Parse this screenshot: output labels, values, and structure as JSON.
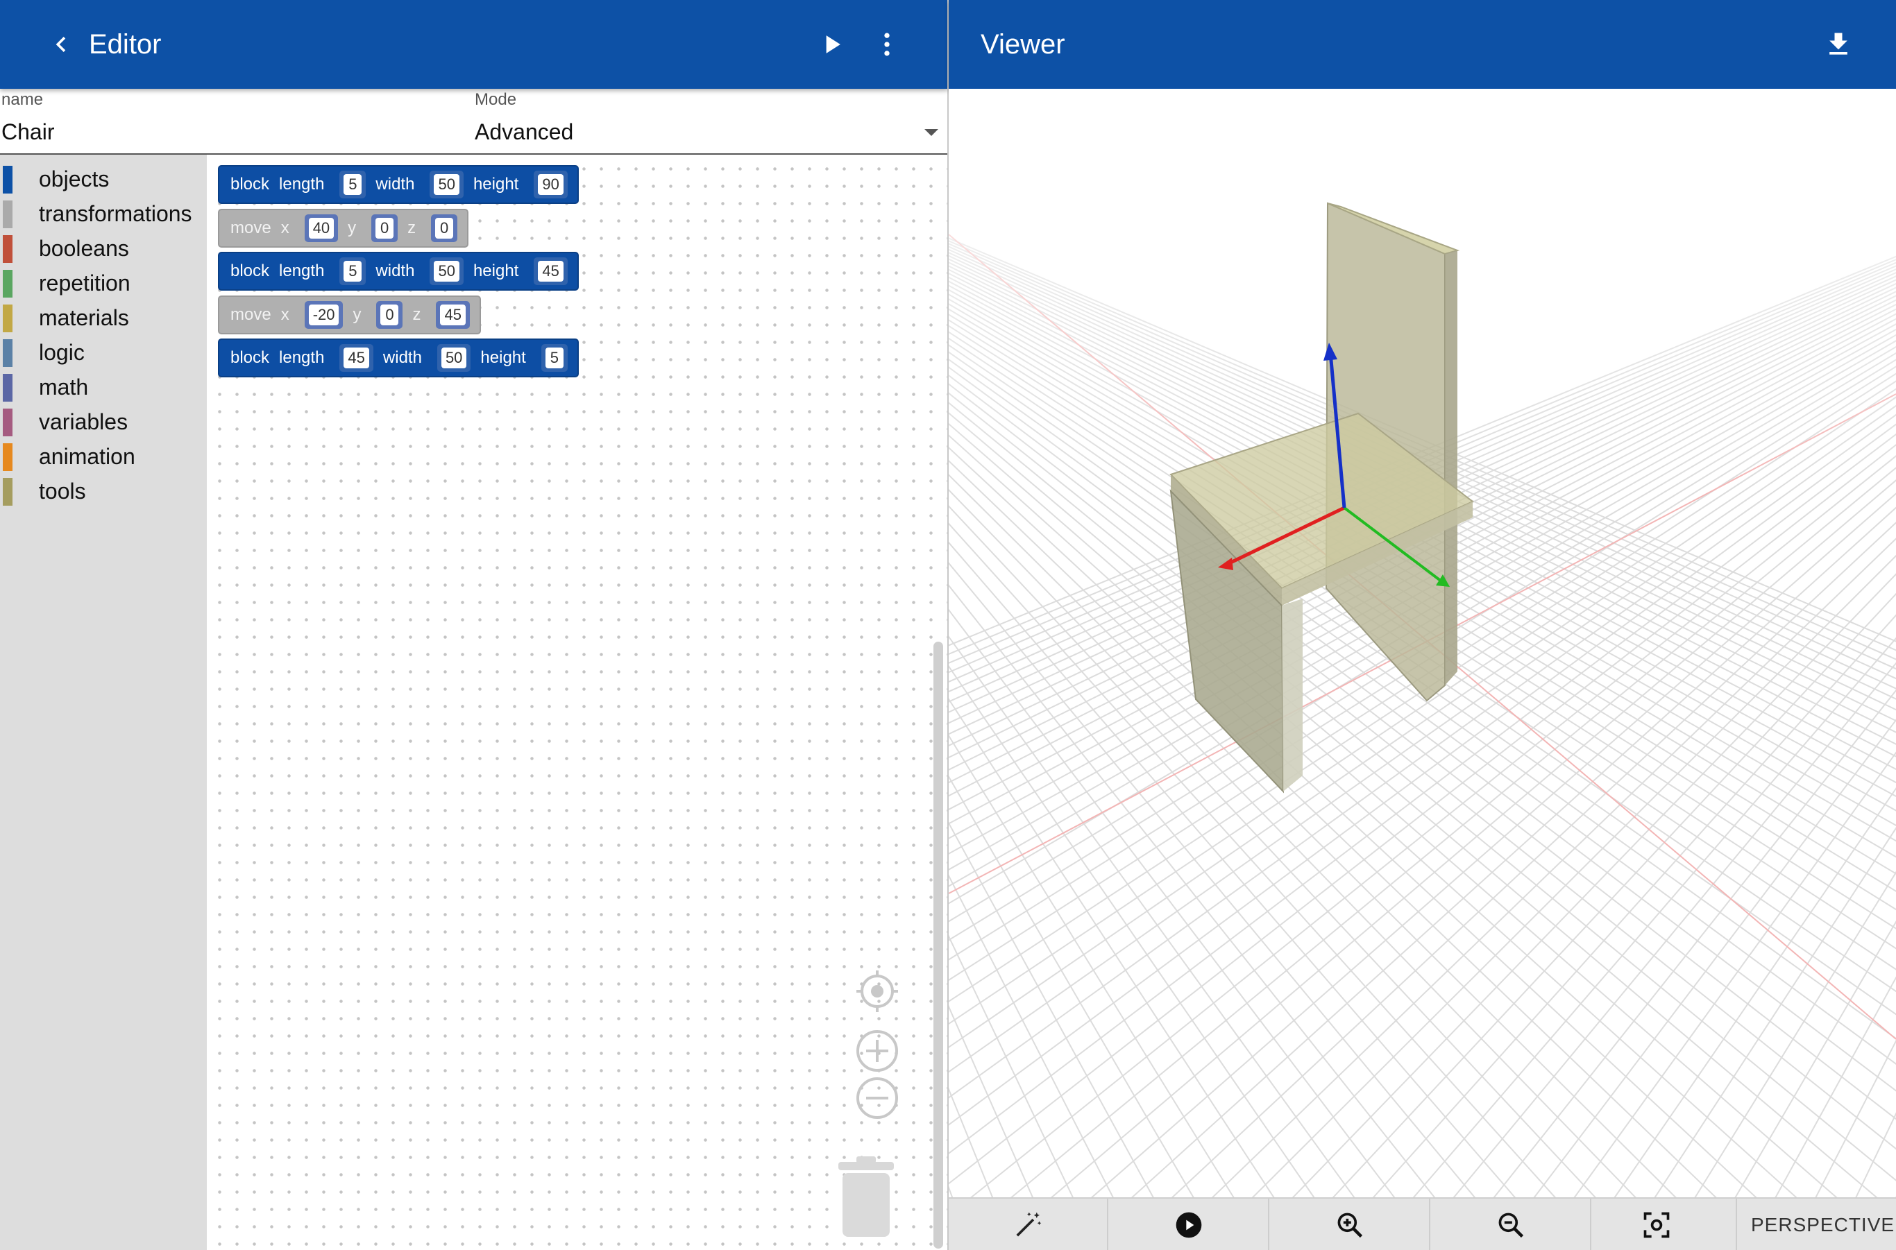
{
  "editor": {
    "title": "Editor",
    "name_label": "name",
    "name_value": "Chair",
    "mode_label": "Mode",
    "mode_value": "Advanced"
  },
  "viewer": {
    "title": "Viewer",
    "projection": "PERSPECTIVE"
  },
  "toolbox": [
    {
      "label": "objects",
      "color": "#0d51a6"
    },
    {
      "label": "transformations",
      "color": "#aaaaaa"
    },
    {
      "label": "booleans",
      "color": "#c0503a"
    },
    {
      "label": "repetition",
      "color": "#5aa661"
    },
    {
      "label": "materials",
      "color": "#c2a845"
    },
    {
      "label": "logic",
      "color": "#5b81a6"
    },
    {
      "label": "math",
      "color": "#5b67a5"
    },
    {
      "label": "variables",
      "color": "#a55b80"
    },
    {
      "label": "animation",
      "color": "#e6891f"
    },
    {
      "label": "tools",
      "color": "#a59d5f"
    }
  ],
  "blocks": [
    {
      "kind": "block",
      "w1": "block",
      "l1": "length",
      "v1": "5",
      "l2": "width",
      "v2": "50",
      "l3": "height",
      "v3": "90"
    },
    {
      "kind": "move",
      "w1": "move",
      "l1": "x",
      "v1": "40",
      "l2": "y",
      "v2": "0",
      "l3": "z",
      "v3": "0"
    },
    {
      "kind": "block",
      "w1": "block",
      "l1": "length",
      "v1": "5",
      "l2": "width",
      "v2": "50",
      "l3": "height",
      "v3": "45"
    },
    {
      "kind": "move",
      "w1": "move",
      "l1": "x",
      "v1": "-20",
      "l2": "y",
      "v2": "0",
      "l3": "z",
      "v3": "45"
    },
    {
      "kind": "block",
      "w1": "block",
      "l1": "length",
      "v1": "45",
      "l2": "width",
      "v2": "50",
      "l3": "height",
      "v3": "5"
    }
  ],
  "icons": {
    "back": "chevron-left-icon",
    "run": "play-icon",
    "menu": "more-vert-icon",
    "download": "download-icon",
    "recenter": "target-icon",
    "zoom_in_ws": "plus-circle-icon",
    "zoom_out_ws": "minus-circle-icon",
    "trash": "trash-icon",
    "magic": "magic-wand-icon",
    "play": "play-circle-icon",
    "zoom_in": "zoom-in-icon",
    "zoom_out": "zoom-out-icon",
    "fit": "fit-screen-icon"
  },
  "colors": {
    "appbar": "#0d51a6",
    "block_blue": "#0d4ea4",
    "block_gray": "#b0b0b0",
    "chair": "#c9c6a3",
    "axis_x": "#e02020",
    "axis_y": "#22aa22",
    "axis_z": "#1530c8"
  }
}
